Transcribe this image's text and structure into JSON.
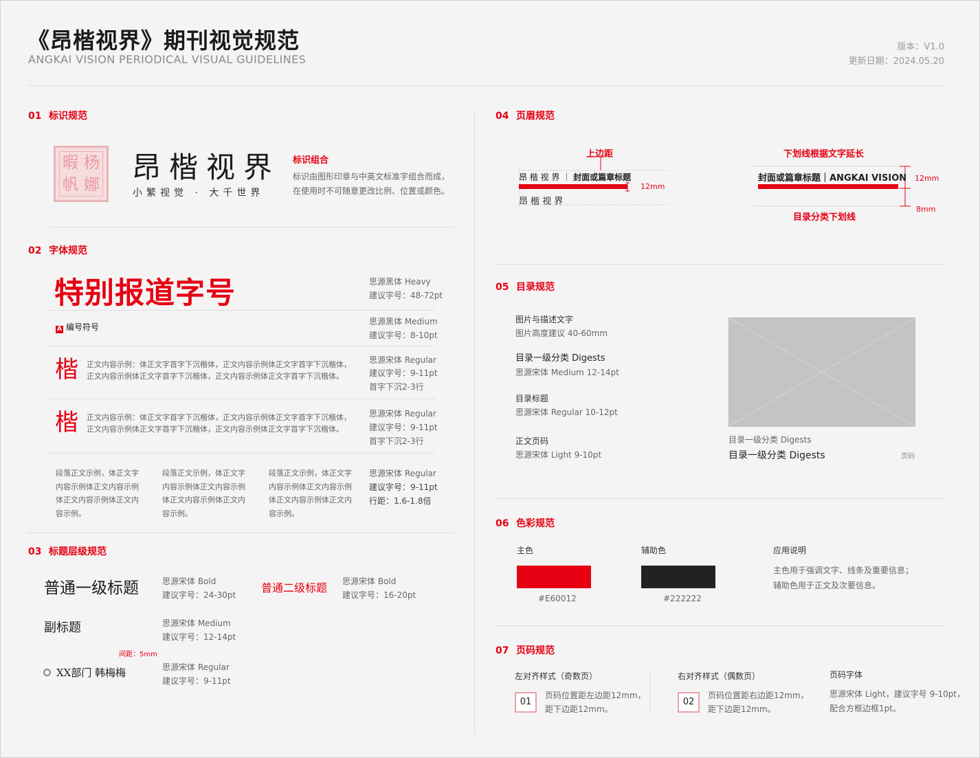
{
  "header": {
    "title": "《昂楷视界》期刊视觉规范",
    "subtitle_en": "ANGKAI VISION PERIODICAL VISUAL GUIDELINES",
    "version": "版本：V1.0",
    "date": "更新日期：2024.05.20"
  },
  "s01": {
    "num": "01",
    "title": "标识规范",
    "seal_chars": [
      "暇",
      "杨",
      "帆",
      "娜"
    ],
    "logo_cn": "昂楷视界",
    "logo_slogan": "小繁视觉 · 大千世界",
    "combo_title": "标识组合",
    "combo_desc1": "标识由图形印章与中英文标准字组合而成，",
    "combo_desc2": "在使用时不可随意更改比例、位置或颜色。"
  },
  "s02": {
    "num": "02",
    "title": "字体规范",
    "special_title": "特别报道字号",
    "row1_font": "思源黑体 Heavy",
    "row1_size": "建议字号：48-72pt",
    "badge": "A",
    "code_label": "编号符号",
    "row2_font": "思源黑体 Medium",
    "row2_size": "建议字号：8-10pt",
    "kai_char": "楷",
    "body_line1": "正文内容示例：体正文字首字下沉楷体，正文内容示例体正文字首字下沉楷体，",
    "body_line2": "正文内容示例体正文字首字下沉楷体，正文内容示例体正文字首字下沉楷体。",
    "row3_font": "思源宋体 Regular",
    "row3_size": "建议字号：9-11pt",
    "row3_drop": "首字下沉2-3行",
    "para_col1": [
      "段落正文示例，体正文字",
      "内容示例体正文内容示例",
      "体正文内容示例体正文内",
      "容示例。"
    ],
    "para_col2": [
      "段落正文示例，体正文字",
      "内容示例体正文内容示例",
      "体正文内容示例体正文内",
      "容示例。"
    ],
    "para_col3": [
      "段落正文示例，体正文字",
      "内容示例体正文内容示例",
      "体正文内容示例体正文内",
      "容示例。"
    ],
    "row5_font": "思源宋体 Regular",
    "row5_size": "建议字号：9-11pt",
    "row5_leading": "行距：1.6-1.8倍"
  },
  "s03": {
    "num": "03",
    "title": "标题层级规范",
    "h1": "普通一级标题",
    "h1_font": "思源宋体 Bold",
    "h1_size": "建议字号：24-30pt",
    "h2": "普通二级标题",
    "h2_font": "思源宋体 Bold",
    "h2_size": "建议字号：16-20pt",
    "sub": "副标题",
    "sub_font": "思源宋体 Medium",
    "sub_size": "建议字号：12-14pt",
    "gap": "间距：5mm",
    "byline": "XX部门 韩梅梅",
    "byline_font": "思源宋体 Regular",
    "byline_size": "建议字号：9-11pt"
  },
  "s04": {
    "num": "04",
    "title": "页眉规范",
    "top_margin_label": "上边距",
    "left_header_text": "昂 楷 视 界 ｜",
    "left_header_bold": "封面或篇章标题",
    "left_dim": "12mm",
    "left_sample": "昂 楷 视 界",
    "underline_label": "下划线根据文字延长",
    "right_header_text": "封面或篇章标题｜ANGKAI VISION",
    "right_dim1": "12mm",
    "right_dim2": "8mm",
    "right_bottom_label": "目录分类下划线"
  },
  "s05": {
    "num": "05",
    "title": "目录规范",
    "items": [
      {
        "title": "图片与描述文字",
        "desc": "图片高度建议 40-60mm"
      },
      {
        "title": "目录一级分类  Digests",
        "desc": "思源宋体 Medium  12-14pt"
      },
      {
        "title": "目录标题",
        "desc": "思源宋体 Regular  10-12pt"
      },
      {
        "title": "正文页码",
        "desc": "思源宋体 Light  9-10pt"
      }
    ],
    "caption_small": "目录一级分类  Digests",
    "caption_big": "目录一级分类  Digests",
    "page_label": "页码"
  },
  "s06": {
    "num": "06",
    "title": "色彩规范",
    "primary_label": "主色",
    "primary_hex": "#E60012",
    "secondary_label": "辅助色",
    "secondary_hex": "#222222",
    "usage_title": "应用说明",
    "usage_line1": "主色用于强调文字、线条及重要信息；",
    "usage_line2": "辅助色用于正文及次要信息。",
    "colors": {
      "primary": "#e60012",
      "secondary": "#222222"
    }
  },
  "s07": {
    "num": "07",
    "title": "页码规范",
    "left_title": "左对齐样式（奇数页）",
    "left_num": "01",
    "left_desc1": "页码位置距左边距12mm，",
    "left_desc2": "距下边距12mm。",
    "right_title": "右对齐样式（偶数页）",
    "right_num": "02",
    "right_desc1": "页码位置距右边距12mm，",
    "right_desc2": "距下边距12mm。",
    "font_title": "页码字体",
    "font_desc1": "思源宋体 Light，建议字号 9-10pt，",
    "font_desc2": "配合方框边框1pt。"
  }
}
